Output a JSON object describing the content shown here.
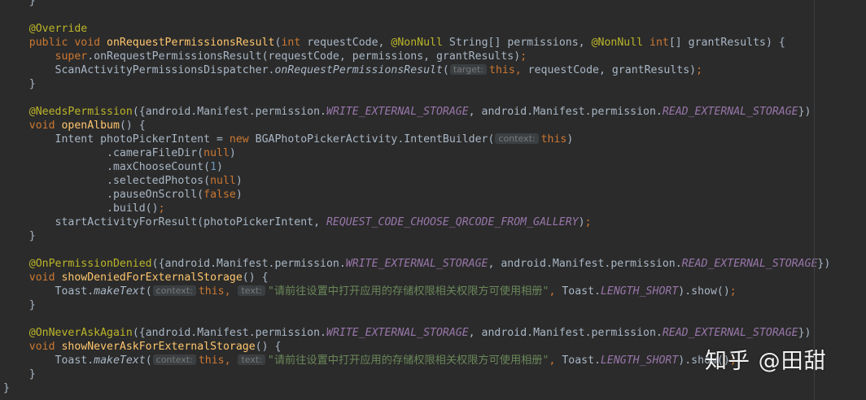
{
  "editor": {
    "theme": "darcula",
    "colors": {
      "background": "#2b2b2b",
      "default": "#a9b7c6",
      "keyword": "#cc7832",
      "annotation": "#bbb529",
      "method": "#ffc66d",
      "static_field": "#9876aa",
      "number": "#6897bb",
      "string": "#6a8759"
    },
    "lines": [
      {
        "tokens": [
          {
            "t": "    }",
            "k": "default"
          }
        ]
      },
      {
        "tokens": []
      },
      {
        "tokens": [
          {
            "t": "    ",
            "k": "default"
          },
          {
            "t": "@Override",
            "k": "ann"
          }
        ]
      },
      {
        "tokens": [
          {
            "t": "    ",
            "k": "default"
          },
          {
            "t": "public void ",
            "k": "kw"
          },
          {
            "t": "onRequestPermissionsResult",
            "k": "fn"
          },
          {
            "t": "(",
            "k": "default"
          },
          {
            "t": "int ",
            "k": "kw"
          },
          {
            "t": "requestCode, ",
            "k": "default"
          },
          {
            "t": "@NonNull ",
            "k": "ann"
          },
          {
            "t": "String[] permissions, ",
            "k": "default"
          },
          {
            "t": "@NonNull ",
            "k": "ann"
          },
          {
            "t": "int",
            "k": "kw"
          },
          {
            "t": "[] grantResults) {",
            "k": "default"
          }
        ]
      },
      {
        "tokens": [
          {
            "t": "        ",
            "k": "default"
          },
          {
            "t": "super",
            "k": "kw"
          },
          {
            "t": ".onRequestPermissionsResult(requestCode, permissions, grantResults)",
            "k": "default"
          },
          {
            "t": ";",
            "k": "kw"
          }
        ]
      },
      {
        "tokens": [
          {
            "t": "        ScanActivityPermissionsDispatcher.",
            "k": "default"
          },
          {
            "t": "onRequestPermissionsResult",
            "k": "italic"
          },
          {
            "t": "(",
            "k": "default"
          },
          {
            "t": "target:",
            "k": "hint"
          },
          {
            "t": "this, ",
            "k": "kw"
          },
          {
            "t": "requestCode, grantResults)",
            "k": "default"
          },
          {
            "t": ";",
            "k": "kw"
          }
        ]
      },
      {
        "tokens": [
          {
            "t": "    }",
            "k": "default"
          }
        ]
      },
      {
        "tokens": []
      },
      {
        "tokens": [
          {
            "t": "    ",
            "k": "default"
          },
          {
            "t": "@NeedsPermission",
            "k": "ann"
          },
          {
            "t": "({android.Manifest.permission.",
            "k": "default"
          },
          {
            "t": "WRITE_EXTERNAL_STORAGE",
            "k": "static"
          },
          {
            "t": ", android.Manifest.permission.",
            "k": "default"
          },
          {
            "t": "READ_EXTERNAL_STORAGE",
            "k": "static"
          },
          {
            "t": "})",
            "k": "default"
          }
        ]
      },
      {
        "tokens": [
          {
            "t": "    ",
            "k": "default"
          },
          {
            "t": "void ",
            "k": "kw"
          },
          {
            "t": "openAlbum",
            "k": "fn"
          },
          {
            "t": "() {",
            "k": "default"
          }
        ]
      },
      {
        "tokens": [
          {
            "t": "        Intent photoPickerIntent = ",
            "k": "default"
          },
          {
            "t": "new ",
            "k": "kw"
          },
          {
            "t": "BGAPhotoPickerActivity.IntentBuilder(",
            "k": "default"
          },
          {
            "t": "context:",
            "k": "hint"
          },
          {
            "t": "this",
            "k": "kw"
          },
          {
            "t": ")",
            "k": "default"
          }
        ]
      },
      {
        "tokens": [
          {
            "t": "                .cameraFileDir(",
            "k": "default"
          },
          {
            "t": "null",
            "k": "kw"
          },
          {
            "t": ")",
            "k": "default"
          }
        ]
      },
      {
        "tokens": [
          {
            "t": "                .maxChooseCount(",
            "k": "default"
          },
          {
            "t": "1",
            "k": "num"
          },
          {
            "t": ")",
            "k": "default"
          }
        ]
      },
      {
        "tokens": [
          {
            "t": "                .selectedPhotos(",
            "k": "default"
          },
          {
            "t": "null",
            "k": "kw"
          },
          {
            "t": ")",
            "k": "default"
          }
        ]
      },
      {
        "tokens": [
          {
            "t": "                .pauseOnScroll(",
            "k": "default"
          },
          {
            "t": "false",
            "k": "kw"
          },
          {
            "t": ")",
            "k": "default"
          }
        ]
      },
      {
        "tokens": [
          {
            "t": "                .build()",
            "k": "default"
          },
          {
            "t": ";",
            "k": "kw"
          }
        ]
      },
      {
        "tokens": [
          {
            "t": "        startActivityForResult(photoPickerIntent, ",
            "k": "default"
          },
          {
            "t": "REQUEST_CODE_CHOOSE_QRCODE_FROM_GALLERY",
            "k": "static"
          },
          {
            "t": ")",
            "k": "default"
          },
          {
            "t": ";",
            "k": "kw"
          }
        ]
      },
      {
        "tokens": [
          {
            "t": "    }",
            "k": "default"
          }
        ]
      },
      {
        "tokens": []
      },
      {
        "tokens": [
          {
            "t": "    ",
            "k": "default"
          },
          {
            "t": "@OnPermissionDenied",
            "k": "ann"
          },
          {
            "t": "({android.Manifest.permission.",
            "k": "default"
          },
          {
            "t": "WRITE_EXTERNAL_STORAGE",
            "k": "static"
          },
          {
            "t": ", android.Manifest.permission.",
            "k": "default"
          },
          {
            "t": "READ_EXTERNAL_STORAGE",
            "k": "static"
          },
          {
            "t": "})",
            "k": "default"
          }
        ]
      },
      {
        "tokens": [
          {
            "t": "    ",
            "k": "default"
          },
          {
            "t": "void ",
            "k": "kw"
          },
          {
            "t": "showDeniedForExternalStorage",
            "k": "fn"
          },
          {
            "t": "() {",
            "k": "default"
          }
        ]
      },
      {
        "tokens": [
          {
            "t": "        Toast.",
            "k": "default"
          },
          {
            "t": "makeText",
            "k": "italic"
          },
          {
            "t": "(",
            "k": "default"
          },
          {
            "t": "context:",
            "k": "hint"
          },
          {
            "t": "this, ",
            "k": "kw"
          },
          {
            "t": "text:",
            "k": "hint"
          },
          {
            "t": "\"请前往设置中打开应用的存储权限相关权限方可使用相册\"",
            "k": "str"
          },
          {
            "t": ", ",
            "k": "kw"
          },
          {
            "t": "Toast.",
            "k": "default"
          },
          {
            "t": "LENGTH_SHORT",
            "k": "static"
          },
          {
            "t": ").show()",
            "k": "default"
          },
          {
            "t": ";",
            "k": "kw"
          }
        ]
      },
      {
        "tokens": [
          {
            "t": "    }",
            "k": "default"
          }
        ]
      },
      {
        "tokens": []
      },
      {
        "tokens": [
          {
            "t": "    ",
            "k": "default"
          },
          {
            "t": "@OnNeverAskAgain",
            "k": "ann"
          },
          {
            "t": "({android.Manifest.permission.",
            "k": "default"
          },
          {
            "t": "WRITE_EXTERNAL_STORAGE",
            "k": "static"
          },
          {
            "t": ", android.Manifest.permission.",
            "k": "default"
          },
          {
            "t": "READ_EXTERNAL_STORAGE",
            "k": "static"
          },
          {
            "t": "})",
            "k": "default"
          }
        ]
      },
      {
        "tokens": [
          {
            "t": "    ",
            "k": "default"
          },
          {
            "t": "void ",
            "k": "kw"
          },
          {
            "t": "showNeverAskForExternalStorage",
            "k": "fn"
          },
          {
            "t": "() {",
            "k": "default"
          }
        ]
      },
      {
        "tokens": [
          {
            "t": "        Toast.",
            "k": "default"
          },
          {
            "t": "makeText",
            "k": "italic"
          },
          {
            "t": "(",
            "k": "default"
          },
          {
            "t": "context:",
            "k": "hint"
          },
          {
            "t": "this, ",
            "k": "kw"
          },
          {
            "t": "text:",
            "k": "hint"
          },
          {
            "t": "\"请前往设置中打开应用的存储权限相关权限方可使用相册\"",
            "k": "str"
          },
          {
            "t": ", ",
            "k": "kw"
          },
          {
            "t": "Toast.",
            "k": "default"
          },
          {
            "t": "LENGTH_SHORT",
            "k": "static"
          },
          {
            "t": ").show()",
            "k": "default"
          },
          {
            "t": ";",
            "k": "kw"
          }
        ]
      },
      {
        "tokens": [
          {
            "t": "    }",
            "k": "default"
          }
        ]
      },
      {
        "tokens": [
          {
            "t": "}",
            "k": "default"
          }
        ]
      }
    ]
  },
  "watermark": {
    "text": "知乎 @田甜"
  }
}
